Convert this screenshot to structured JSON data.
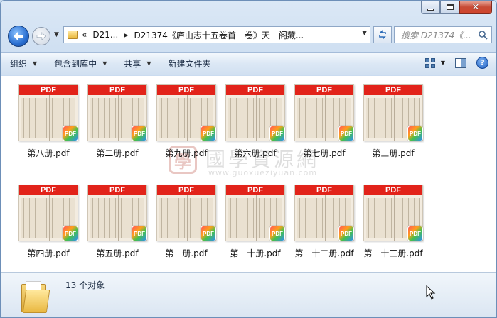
{
  "window": {
    "controls": {
      "minimize": "min",
      "maximize": "max",
      "close": "✕"
    }
  },
  "nav": {
    "breadcrumb_root": "D21...",
    "breadcrumb_current": "D21374《庐山志十五卷首一卷》天一阁藏...",
    "search_placeholder": "搜索 D21374《...",
    "overflow_glyph": "«"
  },
  "toolbar": {
    "organize": "组织",
    "include_in_library": "包含到库中",
    "share": "共享",
    "new_folder": "新建文件夹"
  },
  "watermark": {
    "seal": "學",
    "chinese": "國學資源網",
    "url": "www.guoxueziyuan.com"
  },
  "thumb_header": "PDF",
  "badge": "PDF",
  "files": [
    {
      "name": "第八册.pdf"
    },
    {
      "name": "第二册.pdf"
    },
    {
      "name": "第九册.pdf"
    },
    {
      "name": "第六册.pdf"
    },
    {
      "name": "第七册.pdf"
    },
    {
      "name": "第三册.pdf"
    },
    {
      "name": "第四册.pdf"
    },
    {
      "name": "第五册.pdf"
    },
    {
      "name": "第一册.pdf"
    },
    {
      "name": "第一十册.pdf"
    },
    {
      "name": "第一十二册.pdf"
    },
    {
      "name": "第一十三册.pdf"
    }
  ],
  "status": {
    "count_text": "13 个对象"
  },
  "colors": {
    "pdf_red": "#e2231a",
    "accent": "#2a6fd1"
  }
}
